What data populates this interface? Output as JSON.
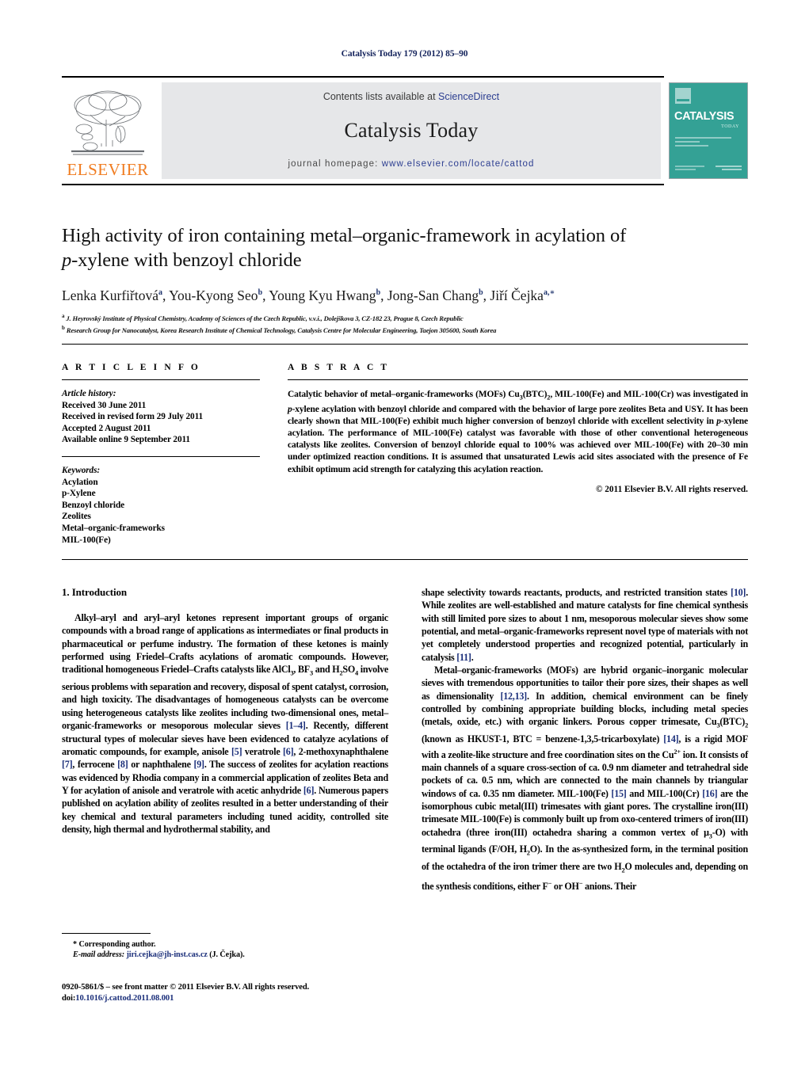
{
  "running_head": "Catalysis Today 179 (2012) 85–90",
  "masthead": {
    "contents_prefix": "Contents lists available at ",
    "sciencedirect": "ScienceDirect",
    "journal_name": "Catalysis Today",
    "homepage_prefix": "journal homepage: ",
    "homepage_url": "www.elsevier.com/locate/cattod",
    "publisher_logo_text": "ELSEVIER",
    "cover": {
      "title": "CATALYSIS",
      "subtitle": "TODAY"
    },
    "accent_color": "#2c3e91",
    "band_color": "#e6e7e9",
    "cover_color": "#34a195",
    "elsevier_orange": "#f07c20"
  },
  "article": {
    "title_line1": "High activity of iron containing metal–organic-framework in acylation of",
    "title_line2_italic": "p",
    "title_line2_rest": "-xylene with benzoyl chloride",
    "authors": [
      {
        "name": "Lenka Kurfiřtová",
        "sup": "a"
      },
      {
        "name": "You-Kyong Seo",
        "sup": "b"
      },
      {
        "name": "Young Kyu Hwang",
        "sup": "b"
      },
      {
        "name": "Jong-San Chang",
        "sup": "b"
      },
      {
        "name": "Jiří Čejka",
        "sup": "a,∗"
      }
    ],
    "affiliations": [
      {
        "marker": "a",
        "text": "J. Heyrovský Institute of Physical Chemistry, Academy of Sciences of the Czech Republic, v.v.i., Dolejškova 3, CZ-182 23, Prague 8, Czech Republic"
      },
      {
        "marker": "b",
        "text": "Research Group for Nanocatalyst, Korea Research Institute of Chemical Technology, Catalysis Centre for Molecular Engineering, Taejon 305600, South Korea"
      }
    ]
  },
  "article_info": {
    "heading": "A R T I C L E   I N F O",
    "history_label": "Article history:",
    "history": [
      "Received 30 June 2011",
      "Received in revised form 29 July 2011",
      "Accepted 2 August 2011",
      "Available online 9 September 2011"
    ],
    "keywords_label": "Keywords:",
    "keywords": [
      "Acylation",
      "p-Xylene",
      "Benzoyl chloride",
      "Zeolites",
      "Metal–organic-frameworks",
      "MIL-100(Fe)"
    ]
  },
  "abstract": {
    "heading": "A B S T R A C T",
    "body_html": "Catalytic behavior of metal–organic-frameworks (MOFs) Cu<sub>3</sub>(BTC)<sub>2</sub>, MIL-100(Fe) and MIL-100(Cr) was investigated in <em>p</em>-xylene acylation with benzoyl chloride and compared with the behavior of large pore zeolites Beta and USY. It has been clearly shown that MIL-100(Fe) exhibit much higher conversion of benzoyl chloride with excellent selectivity in <em>p</em>-xylene acylation. The performance of MIL-100(Fe) catalyst was favorable with those of other conventional heterogeneous catalysts like zeolites. Conversion of benzoyl chloride equal to 100% was achieved over MIL-100(Fe) with 20–30 min under optimized reaction conditions. It is assumed that unsaturated Lewis acid sites associated with the presence of Fe exhibit optimum acid strength for catalyzing this acylation reaction.",
    "copyright": "© 2011 Elsevier B.V. All rights reserved."
  },
  "sections": {
    "intro_heading": "1.  Introduction",
    "left_paragraphs_html": [
      "Alkyl–aryl and aryl–aryl ketones represent important groups of organic compounds with a broad range of applications as intermediates or final products in pharmaceutical or perfume industry. The formation of these ketones is mainly performed using Friedel–Crafts acylations of aromatic compounds. However, traditional homogeneous Friedel–Crafts catalysts like AlCl<sub>3</sub>, BF<sub>3</sub> and H<sub>2</sub>SO<sub>4</sub> involve serious problems with separation and recovery, disposal of spent catalyst, corrosion, and high toxicity. The disadvantages of homogeneous catalysts can be overcome using heterogeneous catalysts like zeolites including two-dimensional ones, metal–organic-frameworks or mesoporous molecular sieves <span class=\"ref\">[1–4]</span>. Recently, different structural types of molecular sieves have been evidenced to catalyze acylations of aromatic compounds, for example, anisole <span class=\"ref\">[5]</span> veratrole <span class=\"ref\">[6]</span>, 2-methoxynaphthalene <span class=\"ref\">[7]</span>, ferrocene <span class=\"ref\">[8]</span> or naphthalene <span class=\"ref\">[9]</span>. The success of zeolites for acylation reactions was evidenced by Rhodia company in a commercial application of zeolites Beta and Y for acylation of anisole and veratrole with acetic anhydride <span class=\"ref\">[6]</span>. Numerous papers published on acylation ability of zeolites resulted in a better understanding of their key chemical and textural parameters including tuned acidity, controlled site density, high thermal and hydrothermal stability, and"
    ],
    "right_paragraphs_html": [
      "shape selectivity towards reactants, products, and restricted transition states <span class=\"ref\">[10]</span>. While zeolites are well-established and mature catalysts for fine chemical synthesis with still limited pore sizes to about 1 nm, mesoporous molecular sieves show some potential, and metal–organic-frameworks represent novel type of materials with not yet completely understood properties and recognized potential, particularly in catalysis <span class=\"ref\">[11]</span>.",
      "Metal–organic-frameworks (MOFs) are hybrid organic–inorganic molecular sieves with tremendous opportunities to tailor their pore sizes, their shapes as well as dimensionality <span class=\"ref\">[12,13]</span>. In addition, chemical environment can be finely controlled by combining appropriate building blocks, including metal species (metals, oxide, etc.) with organic linkers. Porous copper trimesate, Cu<sub>3</sub>(BTC)<sub>2</sub> (known as HKUST-1, BTC = benzene-1,3,5-tricarboxylate) <span class=\"ref\">[14]</span>, is a rigid MOF with a zeolite-like structure and free coordination sites on the Cu<sup>2+</sup> ion. It consists of main channels of a square cross-section of ca. 0.9 nm diameter and tetrahedral side pockets of ca. 0.5 nm, which are connected to the main channels by triangular windows of ca. 0.35 nm diameter. MIL-100(Fe) <span class=\"ref\">[15]</span> and MIL-100(Cr) <span class=\"ref\">[16]</span> are the isomorphous cubic metal(III) trimesates with giant pores. The crystalline iron(III) trimesate MIL-100(Fe) is commonly built up from oxo-centered trimers of iron(III) octahedra (three iron(III) octahedra sharing a common vertex of μ<sub>3</sub>-O) with terminal ligands (F/OH, H<sub>2</sub>O). In the as-synthesized form, in the terminal position of the octahedra of the iron trimer there are two H<sub>2</sub>O molecules and, depending on the synthesis conditions, either F<sup>−</sup> or OH<sup>−</sup> anions. Their"
    ]
  },
  "footnote": {
    "corresponding": "* Corresponding author.",
    "email_label": "E-mail address:",
    "email": "jiri.cejka@jh-inst.cas.cz",
    "email_owner": "(J. Čejka)."
  },
  "imprint": {
    "line1": "0920-5861/$ – see front matter © 2011 Elsevier B.V. All rights reserved.",
    "doi_label": "doi:",
    "doi_value": "10.1016/j.cattod.2011.08.001"
  }
}
